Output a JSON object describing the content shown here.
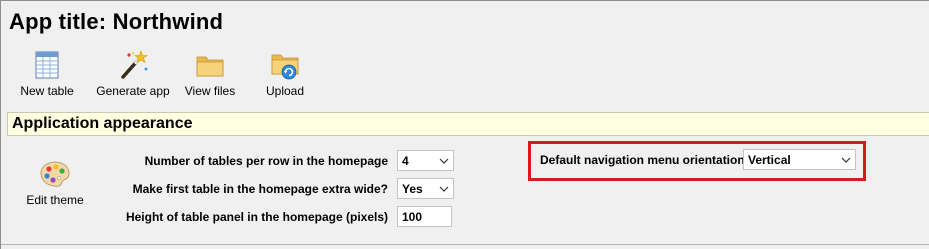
{
  "app": {
    "title": "App title: Northwind"
  },
  "toolbar": {
    "items": [
      {
        "label": "New table",
        "icon": "table-grid-icon"
      },
      {
        "label": "Generate app",
        "icon": "magic-wand-icon"
      },
      {
        "label": "View files",
        "icon": "folder-icon"
      },
      {
        "label": "Upload",
        "icon": "folder-upload-icon"
      }
    ]
  },
  "section": {
    "title": "Application appearance"
  },
  "theme": {
    "label": "Edit theme",
    "icon": "palette-icon"
  },
  "settings": {
    "tables_per_row": {
      "label": "Number of tables per row in the homepage",
      "value": "4"
    },
    "first_table_wide": {
      "label": "Make first table in the homepage extra wide?",
      "value": "Yes"
    },
    "panel_height": {
      "label": "Height of table panel in the homepage (pixels)",
      "value": "100"
    },
    "nav_orientation": {
      "label": "Default navigation menu orientation",
      "value": "Vertical"
    }
  },
  "colors": {
    "section_bg": "#ffffe1",
    "highlight": "#d9191c"
  }
}
